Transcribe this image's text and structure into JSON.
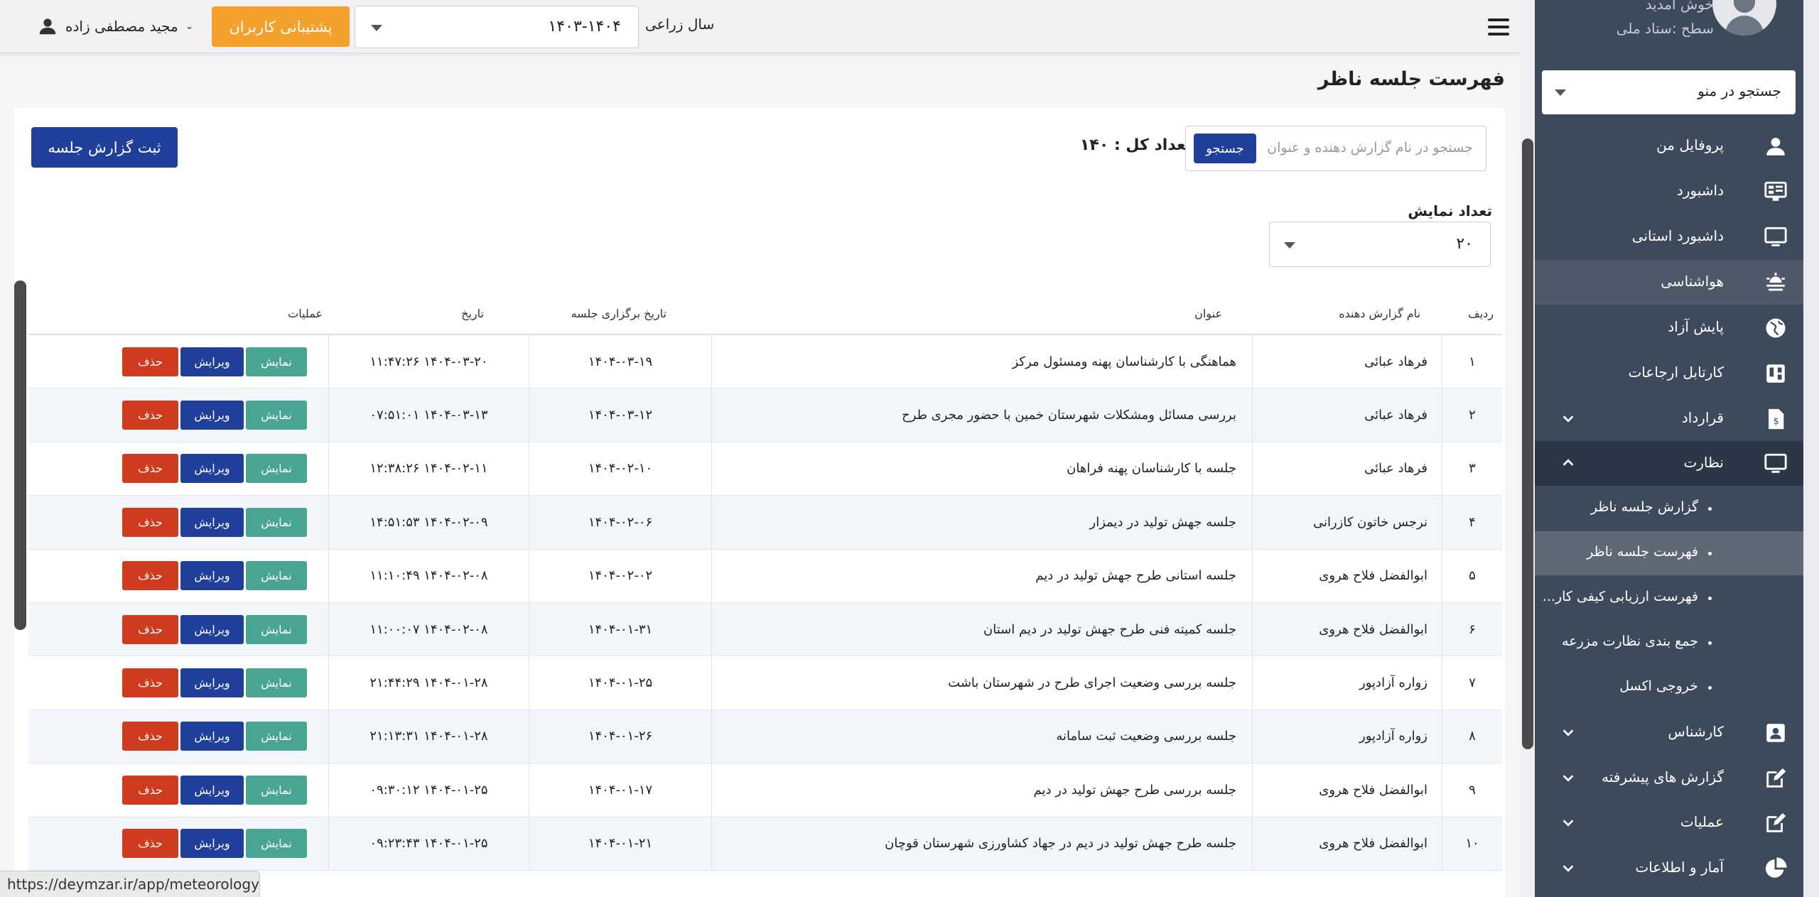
{
  "topbar": {
    "user_name": "مجید مصطفی زاده",
    "support_label": "پشتیبانی کاربران",
    "year_label": "سال زراعی",
    "year_value": "۱۴۰۳-۱۴۰۴"
  },
  "page": {
    "title": "فهرست جلسه ناظر",
    "add_button": "ثبت گزارش جلسه",
    "total_label": "تعداد کل : ۱۴۰",
    "search_placeholder": "جستجو در نام گزارش دهنده و عنوان",
    "search_button": "جستجو",
    "count_label": "تعداد نمایش",
    "count_value": "۲۰"
  },
  "table": {
    "headers": {
      "index": "ردیف",
      "reporter": "نام گزارش دهنده",
      "title": "عنوان",
      "meeting_date": "تاریخ برگزاری جلسه",
      "date": "تاریخ",
      "ops": "عملیات"
    },
    "actions": {
      "show": "نمایش",
      "edit": "ویرایش",
      "delete": "حذف"
    },
    "rows": [
      {
        "idx": "۱",
        "reporter": "فرهاد عبائی",
        "title": "هماهنگی با کارشناسان پهنه ومسئول مرکز",
        "meeting_date": "۱۴۰۴-۰۳-۱۹",
        "date": "۱۴۰۴-۰۳-۲۰ ۱۱:۴۷:۲۶"
      },
      {
        "idx": "۲",
        "reporter": "فرهاد عبائی",
        "title": "بررسی مسائل ومشکلات شهرستان خمین با حضور مجری طرح",
        "meeting_date": "۱۴۰۴-۰۳-۱۲",
        "date": "۱۴۰۴-۰۳-۱۳ ۰۷:۵۱:۰۱"
      },
      {
        "idx": "۳",
        "reporter": "فرهاد عبائی",
        "title": "جلسه با کارشناسان پهنه فراهان",
        "meeting_date": "۱۴۰۴-۰۲-۱۰",
        "date": "۱۴۰۴-۰۲-۱۱ ۱۲:۳۸:۲۶"
      },
      {
        "idx": "۴",
        "reporter": "نرجس خاتون کازرانی",
        "title": "جلسه جهش تولید در دیمزار",
        "meeting_date": "۱۴۰۴-۰۲-۰۶",
        "date": "۱۴۰۴-۰۲-۰۹ ۱۴:۵۱:۵۳"
      },
      {
        "idx": "۵",
        "reporter": "ابوالفضل فلاح هروی",
        "title": "جلسه استانی طرح جهش تولید در دیم",
        "meeting_date": "۱۴۰۴-۰۲-۰۲",
        "date": "۱۴۰۴-۰۲-۰۸ ۱۱:۱۰:۴۹"
      },
      {
        "idx": "۶",
        "reporter": "ابوالفضل فلاح هروی",
        "title": "جلسه کمیته فنی طرح جهش تولید در دیم استان",
        "meeting_date": "۱۴۰۴-۰۱-۳۱",
        "date": "۱۴۰۴-۰۲-۰۸ ۱۱:۰۰:۰۷"
      },
      {
        "idx": "۷",
        "reporter": "زواره آزادپور",
        "title": "جلسه بررسی وضعیت اجرای طرح در شهرستان باشت",
        "meeting_date": "۱۴۰۴-۰۱-۲۵",
        "date": "۱۴۰۴-۰۱-۲۸ ۲۱:۴۴:۲۹"
      },
      {
        "idx": "۸",
        "reporter": "زواره آزادپور",
        "title": "جلسه بررسی وضعیت ثبت سامانه",
        "meeting_date": "۱۴۰۴-۰۱-۲۶",
        "date": "۱۴۰۴-۰۱-۲۸ ۲۱:۱۳:۳۱"
      },
      {
        "idx": "۹",
        "reporter": "ابوالفضل فلاح هروی",
        "title": "جلسه بررسی طرح جهش تولید در دیم",
        "meeting_date": "۱۴۰۴-۰۱-۱۷",
        "date": "۱۴۰۴-۰۱-۲۵ ۰۹:۳۰:۱۲"
      },
      {
        "idx": "۱۰",
        "reporter": "ابوالفضل فلاح هروی",
        "title": "جلسه طرح جهش تولید در دیم در جهاد کشاورزی شهرستان قوچان",
        "meeting_date": "۱۴۰۴-۰۱-۲۱",
        "date": "۱۴۰۴-۰۱-۲۵ ۰۹:۲۳:۴۳"
      }
    ]
  },
  "statusbar": {
    "url": "https://deymzar.ir/app/meteorology"
  },
  "sidebar": {
    "welcome": "خوش آمدید",
    "level": "سطح :ستاد ملی",
    "menu_search": "جستجو در منو",
    "items": [
      {
        "label": "پروفایل من",
        "icon": "person-icon"
      },
      {
        "label": "داشبورد",
        "icon": "dashboard-icon"
      },
      {
        "label": "داشبورد استانی",
        "icon": "monitor-icon"
      },
      {
        "label": "هواشناسی",
        "icon": "weather-icon"
      },
      {
        "label": "پایش آزاد",
        "icon": "globe-icon"
      },
      {
        "label": "کارتابل ارجاعات",
        "icon": "kanban-icon"
      },
      {
        "label": "قرارداد",
        "icon": "contract-icon"
      },
      {
        "label": "نظارت",
        "icon": "monitor-icon"
      },
      {
        "label": "کارشناس",
        "icon": "id-card-icon"
      },
      {
        "label": "گزارش های پیشرفته",
        "icon": "edit-icon"
      },
      {
        "label": "عملیات",
        "icon": "edit-icon"
      },
      {
        "label": "آمار و اطلاعات",
        "icon": "pie-chart-icon"
      }
    ],
    "subitems": [
      {
        "label": "گزارش جلسه ناظر"
      },
      {
        "label": "فهرست جلسه ناظر"
      },
      {
        "label": "فهرست ارزیابی کیفی کار..."
      },
      {
        "label": "جمع بندی نظارت مزرعه"
      },
      {
        "label": "خروجی اکسل"
      }
    ]
  }
}
